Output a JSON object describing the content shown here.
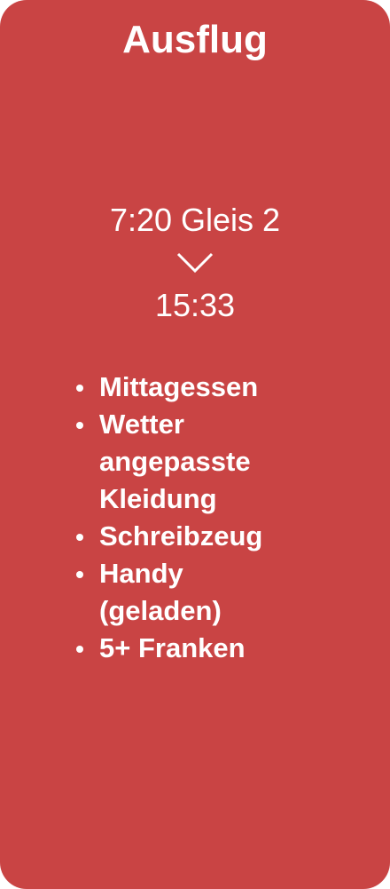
{
  "card": {
    "title": "Ausflug",
    "departure": "7:20 Gleis 2",
    "arrow_icon": "chevron-down-icon",
    "arrival": "15:33",
    "checklist": [
      "Mittagessen",
      "Wetter angepasste Kleidung",
      "Schreibzeug",
      "Handy (geladen)",
      "5+ Franken"
    ],
    "color": "#c94444"
  }
}
